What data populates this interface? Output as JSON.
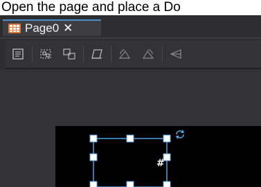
{
  "instruction": {
    "text": "Open the page and place a Do"
  },
  "tabs": [
    {
      "label": "Page0",
      "close_glyph": "✕"
    }
  ],
  "icons": {
    "tab": "page-grid-icon",
    "toolbar": [
      "page-properties-icon",
      "group-icon",
      "ungroup-icon",
      "skew-icon",
      "rotate-left-icon",
      "rotate-right-icon",
      "flip-icon"
    ],
    "canvas": [
      "rotate-handle-icon"
    ]
  },
  "canvas": {
    "selected_shape_text": "#"
  },
  "colors": {
    "app_background": "#2d2d30",
    "toolbar_background": "#333337",
    "canvas_background": "#000000",
    "tab_accent": "#4f8fc9",
    "selection": "#4fa3e0"
  }
}
